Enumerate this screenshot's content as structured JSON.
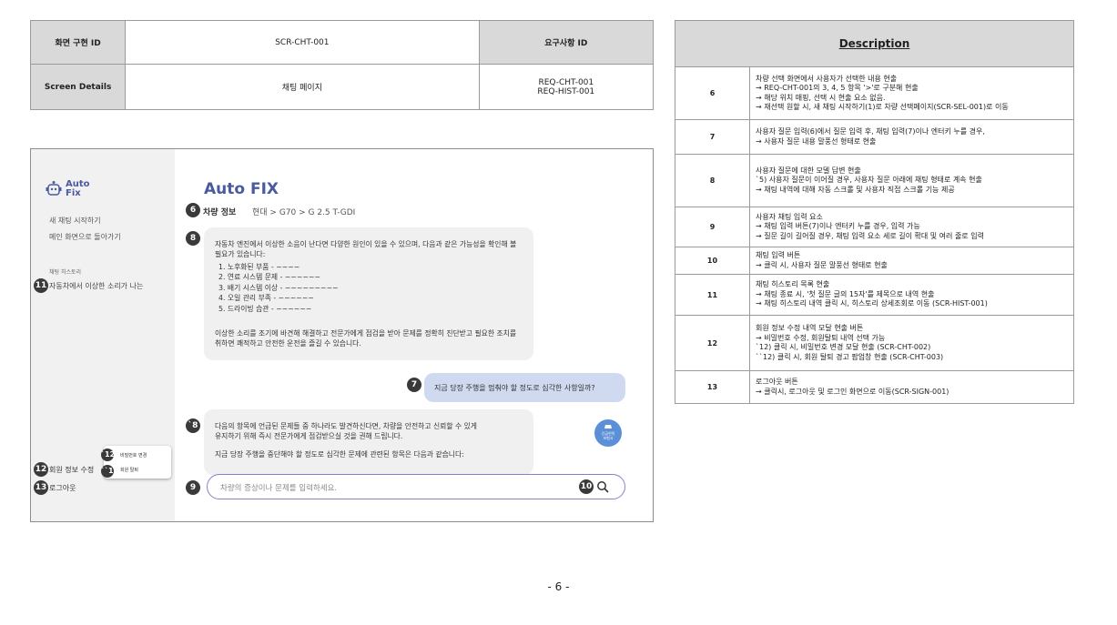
{
  "id_table": {
    "screen_id_label": "화면 구현 ID",
    "screen_id_value": "SCR-CHT-001",
    "req_id_label": "요구사항 ID",
    "details_label": "Screen Details",
    "details_value": "채팅 페이지",
    "req_ids": [
      "REQ-CHT-001",
      "REQ-HIST-001"
    ]
  },
  "description": {
    "header": "Description",
    "rows": [
      {
        "num": "6",
        "lines": [
          "차량 선택 화면에서 사용자가 선택한 내용 현출",
          "→ REQ-CHT-001의 3, 4, 5 항목 '>'로 구분해 현출",
          "→ 해당 위치 매핑, 선택 시 현출 요소 없음.",
          "→ 재선택 원할 시, 새 채팅 시작하기(1)로 차량 선택페이지(SCR-SEL-001)로 이동"
        ]
      },
      {
        "num": "7",
        "lines": [
          "사용자 질문 입력(6)에서 질문 입력 후, 채팅 입력(7)이나 엔터키 누를 경우,",
          "→ 사용자 질문 내용 말풍선 형태로 현출"
        ]
      },
      {
        "num": "8",
        "lines": [
          "사용자 질문에 대한 모델 답변 현출",
          "`5) 사용자 질문이 이어질 경우, 사용자 질문 아래에 채팅 형태로 계속 현출",
          "→ 채팅 내역에 대해 자동 스크롤 및 사용자 직접 스크롤 기능 제공"
        ]
      },
      {
        "num": "9",
        "lines": [
          "사용자 채팅 입력 요소",
          "→ 채팅 입력 버튼(7)이나 엔터키 누를 경우, 입력 가능",
          "→ 질문 길이 길어질 경우, 채팅 입력 요소 세로 길이 확대 및 여러 줄로 입력"
        ]
      },
      {
        "num": "10",
        "lines": [
          "채팅 입력 버튼",
          "→ 클릭 시, 사용자 질문 말풍선 형태로 현출"
        ]
      },
      {
        "num": "11",
        "lines": [
          "채팅 히스토리 목록 현출",
          "→ 채팅 종료 시, '첫 질문 글의 15자'를 제목으로 내역 현출",
          "→ 채팅 히스토리 내역 클릭 시, 히스토리 상세조회로 이동 (SCR-HIST-001)"
        ]
      },
      {
        "num": "12",
        "lines": [
          "회원 정보 수정 내역 모달 현출 버튼",
          "→ 비밀번호 수정, 회원탈퇴 내역 선택 가능",
          "`12) 클릭 시, 비밀번호 변경 모달 현출 (SCR-CHT-002)",
          "``12) 클릭 시, 회원 탈퇴 경고 팝업창 현출 (SCR-CHT-003)"
        ]
      },
      {
        "num": "13",
        "lines": [
          "로그아웃 버튼",
          "→ 클릭시, 로그아웃 및 로그인 화면으로 이동(SCR-SIGN-001)"
        ]
      }
    ]
  },
  "mockup": {
    "logo_line1": "Auto",
    "logo_line2": "Fix",
    "new_chat": "새 채팅 시작하기",
    "back_main": "메인 화면으로 돌아가기",
    "history_label": "채팅 히스토리",
    "history_item": "자동차에서 이상한 소리가 나는",
    "member_edit": "회원 정보 수정",
    "logout": "로그아웃",
    "popup_pw": "비밀번호 변경",
    "popup_withdraw": "회원 탈퇴",
    "title": "Auto FIX",
    "vehicle_label": "차량 정보",
    "vehicle_path": "현대 > G70 > G 2.5 T-GDI",
    "answer1": {
      "intro": [
        "자동차 엔진에서 이상한 소음이 난다면 다양한 원인이 있을 수 있으며, 다음과 같은 가능성을 확인해 볼",
        "필요가 있습니다:"
      ],
      "items": [
        "1. 노후화된 부품 - ~~~~",
        "2. 연료 시스템 문제 - ~~~~~~",
        "3. 배기 시스템 이상 - ~~~~~~~~~",
        "4. 오일 관리 부족 - ~~~~~~",
        "5. 드라이빙 습관 - ~~~~~~"
      ],
      "outro": [
        "이상한 소리를 조기에 바견해 해결하고 전문가에게 점검을 받아 문제를 정확히 진단받고 필요한 조치를",
        "취하면 쾌적하고 안전한 운전을 즐길 수 있습니다."
      ]
    },
    "user_question": "지금 당장 주행을 멈춰야 할 정도로 심각한 사항일까?",
    "answer2": [
      "다음의 항목에 언급된 문제들 중 하나라도 발견하신다면, 차량을 안전하고 신뢰할 수 있게",
      "유지하기 위해 즉시 전문가에게 점검받으실 것을 권해 드립니다.",
      "지금 당장 주행을 중단해야 할 정도로 심각한 문제에 관련된 항목은 다음과 같습니다:"
    ],
    "fab_line1": "긴급연락",
    "fab_line2": "보험사",
    "input_placeholder": "차량의 증상이나 문제를 입력하세요.",
    "badges": {
      "b6": "6",
      "b7": "7",
      "b8": "8",
      "b8b": "`8",
      "b9": "9",
      "b10": "10",
      "b11": "11",
      "b12": "12",
      "b12a": "`12",
      "b12b": "``12",
      "b13": "13"
    }
  },
  "page_number": "- 6 -",
  "colors": {
    "accent": "#4a5a9e",
    "user_bubble": "#cfdaf0",
    "bot_bubble": "#f0f0f0",
    "input_border": "#8a7fc8",
    "badge": "#3a3a3a",
    "header_gray": "#d9d9d9"
  }
}
